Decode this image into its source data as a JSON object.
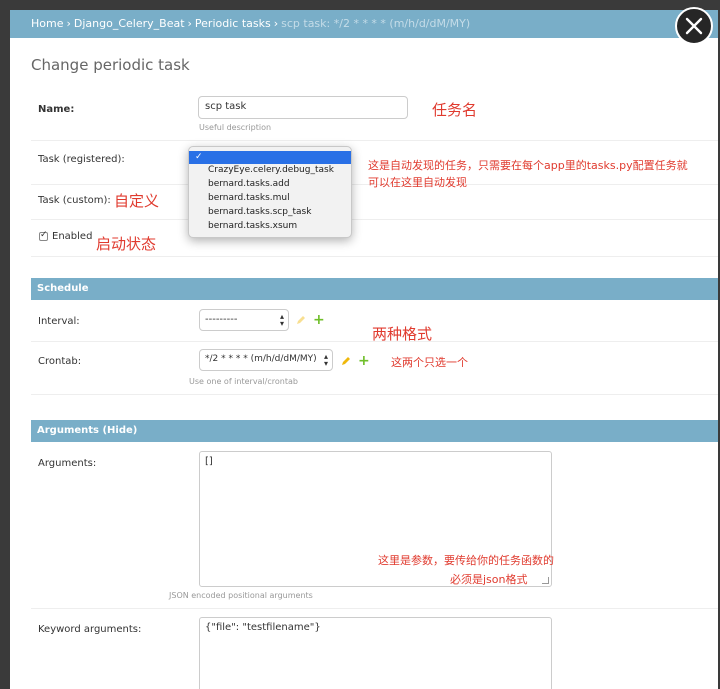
{
  "breadcrumbs": {
    "home": "Home",
    "app": "Django_Celery_Beat",
    "model": "Periodic tasks",
    "current": "scp task: */2 * * * * (m/h/d/dM/MY)",
    "separator": "›"
  },
  "page_title": "Change periodic task",
  "fields": {
    "name_label": "Name:",
    "name_value": "scp task",
    "name_help": "Useful description",
    "task_registered_label": "Task (registered):",
    "task_custom_label": "Task (custom):",
    "enabled_label": "Enabled",
    "enabled_checked": true
  },
  "task_dropdown": {
    "selected_mark": "✓",
    "options": [
      "CrazyEye.celery.debug_task",
      "bernard.tasks.add",
      "bernard.tasks.mul",
      "bernard.tasks.scp_task",
      "bernard.tasks.xsum"
    ]
  },
  "schedule": {
    "section_title": "Schedule",
    "interval_label": "Interval:",
    "interval_value": "---------",
    "crontab_label": "Crontab:",
    "crontab_value": "*/2 * * * * (m/h/d/dM/MY)",
    "help": "Use one of interval/crontab",
    "add_symbol": "+"
  },
  "arguments": {
    "section_title": "Arguments (Hide)",
    "arguments_label": "Arguments:",
    "arguments_value": "[]",
    "arguments_help": "JSON encoded positional arguments",
    "kwargs_label": "Keyword arguments:",
    "kwargs_value": "{\"file\": \"testfilename\"}"
  },
  "annotations": {
    "task_name": "任务名",
    "auto_discover": "这是自动发现的任务，只需要在每个app里的tasks.py配置任务就",
    "auto_discover_2": "可以在这里自动发现",
    "custom": "自定义",
    "enabled_state": "启动状态",
    "two_formats": "两种格式",
    "choose_one": "这两个只选一个",
    "args_note": "这里是参数，要传给你的任务函数的",
    "args_note_2": "必须是json格式"
  },
  "colors": {
    "header": "#79aec8",
    "annotation": "#e03a2e",
    "dropdown_highlight": "#2970e6",
    "add_icon": "#70bf2b",
    "edit_icon": "#efb80b"
  },
  "icons": {
    "close": "close-icon",
    "edit": "pencil-icon",
    "add": "plus-icon"
  }
}
